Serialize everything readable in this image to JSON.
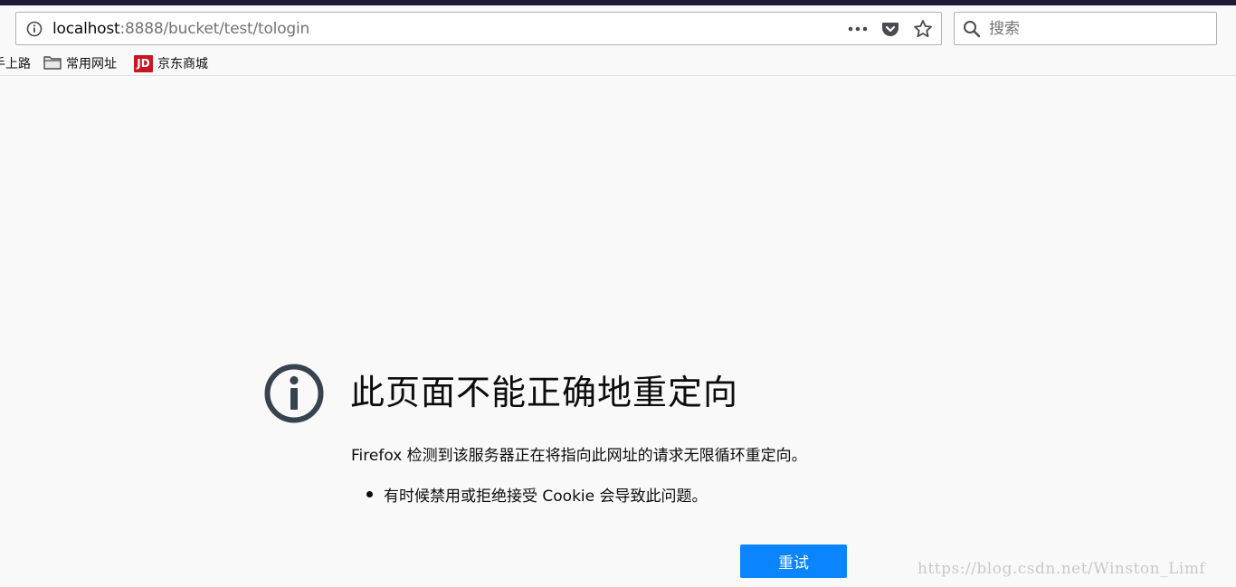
{
  "browser": {
    "url": {
      "host": "localhost",
      "path": ":8888/bucket/test/tologin"
    },
    "page_actions_icon": "ellipsis-icon",
    "pocket_icon": "pocket-icon",
    "bookmark_star_icon": "star-icon",
    "search": {
      "placeholder": "搜索"
    }
  },
  "bookmarks": [
    {
      "label": "手上路",
      "icon": "firefox-icon"
    },
    {
      "label": "常用网址",
      "icon": "folder-icon"
    },
    {
      "label": "京东商城",
      "icon": "jd-logo",
      "logo_text": "JD"
    }
  ],
  "error_page": {
    "title": "此页面不能正确地重定向",
    "description": "Firefox 检测到该服务器正在将指向此网址的请求无限循环重定向。",
    "bullets": [
      "有时候禁用或拒绝接受 Cookie 会导致此问题。"
    ],
    "retry_label": "重试",
    "accent_color": "#0a84ff",
    "icon_color": "#38434f"
  },
  "watermark": "https://blog.csdn.net/Winston_Limf"
}
